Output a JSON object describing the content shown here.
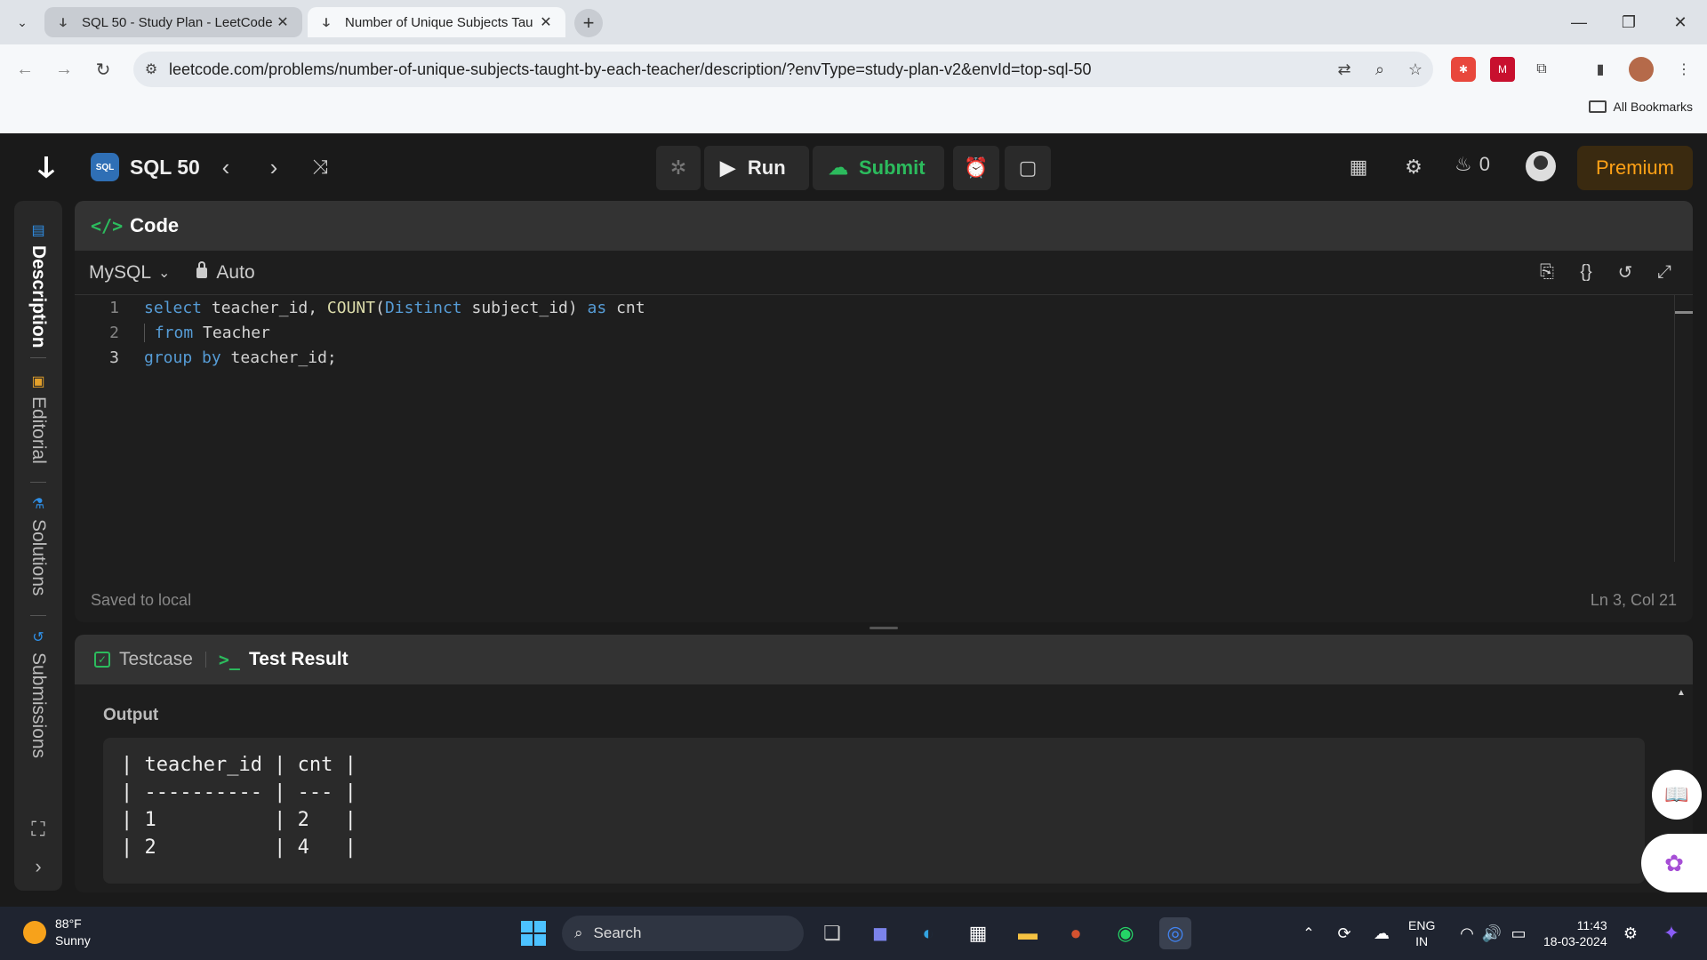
{
  "browser": {
    "tabs": [
      {
        "title": "SQL 50 - Study Plan - LeetCode",
        "active": false
      },
      {
        "title": "Number of Unique Subjects Tau",
        "active": true
      }
    ],
    "url": "leetcode.com/problems/number-of-unique-subjects-taught-by-each-teacher/description/?envType=study-plan-v2&envId=top-sql-50",
    "bookmarks_label": "All Bookmarks"
  },
  "header": {
    "plan_title": "SQL 50",
    "plan_icon_text": "SQL",
    "run_label": "Run",
    "submit_label": "Submit",
    "streak_count": "0",
    "premium_label": "Premium"
  },
  "rail": {
    "items": [
      {
        "label": "Description",
        "active": true,
        "icon": "description-icon"
      },
      {
        "label": "Editorial",
        "active": false,
        "icon": "editorial-icon"
      },
      {
        "label": "Solutions",
        "active": false,
        "icon": "solutions-icon"
      },
      {
        "label": "Submissions",
        "active": false,
        "icon": "submissions-icon"
      }
    ]
  },
  "code_panel": {
    "title": "Code",
    "language": "MySQL",
    "mode": "Auto",
    "lines": [
      {
        "num": "1"
      },
      {
        "num": "2"
      },
      {
        "num": "3"
      }
    ],
    "status_left": "Saved to local",
    "status_right": "Ln 3, Col 21"
  },
  "code_tokens": {
    "l1": [
      "select",
      " teacher_id, ",
      "COUNT",
      "(",
      "Distinct",
      " subject_id) ",
      "as",
      " cnt"
    ],
    "l2": [
      " ",
      "from",
      " Teacher"
    ],
    "l3": [
      "group by",
      " teacher_id;"
    ]
  },
  "result_panel": {
    "tab_testcase": "Testcase",
    "tab_result": "Test Result",
    "output_label": "Output",
    "output_lines": [
      "| teacher_id | cnt |",
      "| ---------- | --- |",
      "| 1          | 2   |",
      "| 2          | 4   |"
    ]
  },
  "taskbar": {
    "temperature": "88°F",
    "weather": "Sunny",
    "search_label": "Search",
    "lang_line1": "ENG",
    "lang_line2": "IN",
    "time": "11:43",
    "date": "18-03-2024"
  },
  "colors": {
    "accent_green": "#2cbb5d",
    "premium_orange": "#ffa116",
    "keyword_blue": "#569cd6",
    "function_yellow": "#dcdcaa"
  }
}
